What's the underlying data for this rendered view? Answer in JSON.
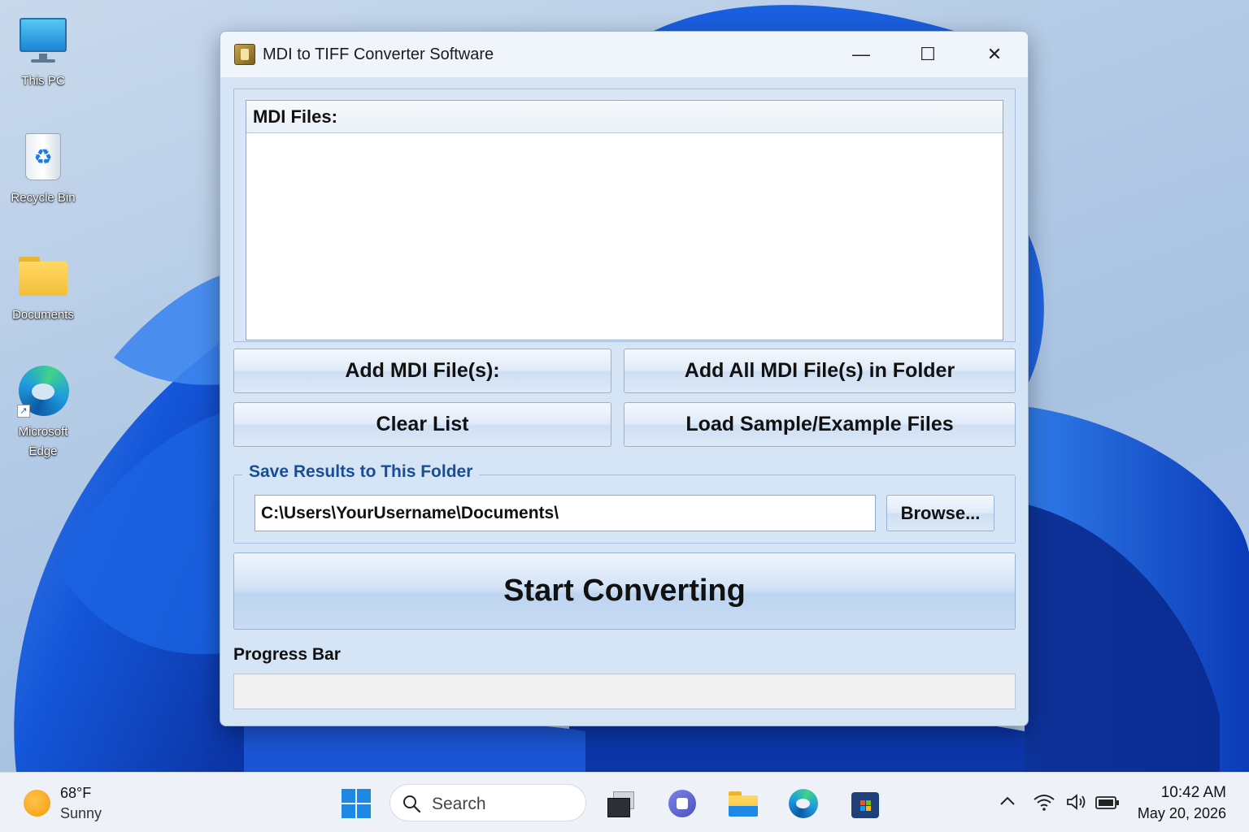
{
  "desktop": {
    "icons": [
      {
        "label": "This PC"
      },
      {
        "label": "Recycle Bin"
      },
      {
        "label": "Documents"
      },
      {
        "label": "Microsoft Edge"
      }
    ]
  },
  "window": {
    "title": "MDI to TIFF Converter Software",
    "minimize_glyph": "—",
    "maximize_glyph": "☐",
    "close_glyph": "✕",
    "files_header": "MDI Files:",
    "buttons": {
      "add_files": "Add MDI File(s):",
      "add_folder": "Add All MDI File(s) in Folder",
      "clear_list": "Clear List",
      "load_samples": "Load Sample/Example Files",
      "browse": "Browse...",
      "start": "Start Converting"
    },
    "save_group_label": "Save Results to This Folder",
    "output_path": "C:\\Users\\YourUsername\\Documents\\",
    "progress_label": "Progress Bar",
    "progress_value": 0
  },
  "taskbar": {
    "weather_temp": "68°F",
    "weather_condition": "Sunny",
    "search_placeholder": "Search",
    "time": "10:42 AM",
    "date": "May 20, 2026"
  },
  "colors": {
    "accent": "#1e88e5",
    "group_label": "#1a4e93"
  }
}
